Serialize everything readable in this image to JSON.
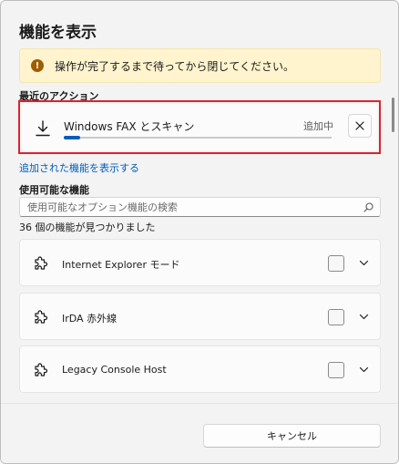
{
  "dialog": {
    "title": "機能を表示"
  },
  "warning": {
    "icon": "warning-icon",
    "text": "操作が完了するまで待ってから閉じてください。"
  },
  "recent": {
    "label": "最近のアクション",
    "item": {
      "name": "Windows FAX とスキャン",
      "status": "追加中",
      "progress": 0.06
    }
  },
  "links": {
    "view_added": "追加された機能を表示する"
  },
  "available": {
    "label": "使用可能な機能",
    "search_placeholder": "使用可能なオプション機能の検索",
    "count_text": "36 個の機能が見つかりました",
    "features": [
      {
        "name": "Internet Explorer モード",
        "checked": false
      },
      {
        "name": "IrDA 赤外線",
        "checked": false
      },
      {
        "name": "Legacy Console Host",
        "checked": false
      }
    ]
  },
  "footer": {
    "cancel_label": "キャンセル"
  },
  "colors": {
    "accent": "#005fb8",
    "highlight": "#d9232e",
    "warning_bg": "#fff4ce"
  }
}
